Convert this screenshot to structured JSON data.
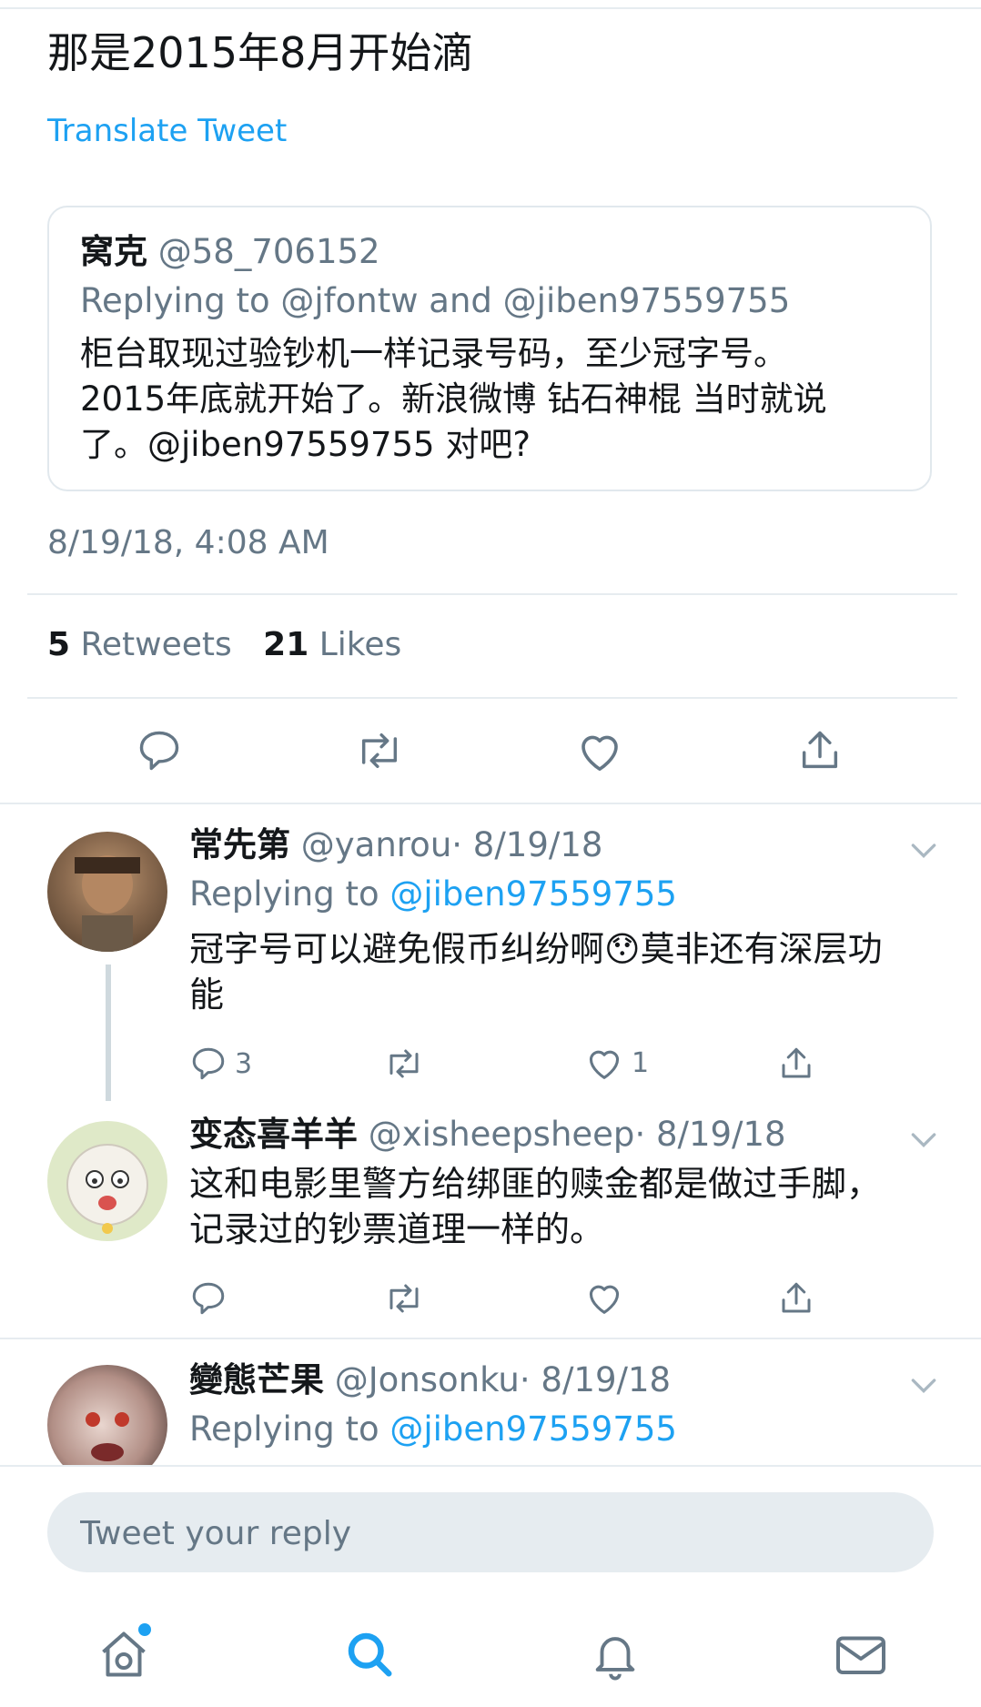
{
  "tweet": {
    "text": "那是2015年8月开始滴",
    "translate_label": "Translate Tweet",
    "quoted": {
      "name": "窝克",
      "handle": "@58_706152",
      "replying_prefix": "Replying to ",
      "replying_user1": "@jfontw",
      "replying_and": " and ",
      "replying_user2": "@jiben97559755",
      "text_lines": [
        "柜台取现过验钞机一样记录号码，至少冠字号。",
        "2015年底就开始了。新浪微博 钻石神棍 当时就说",
        "了。@jiben97559755 对吧?"
      ]
    },
    "timestamp": "8/19/18, 4:08 AM",
    "retweets_count": "5",
    "retweets_label": "Retweets",
    "likes_count": "21",
    "likes_label": "Likes"
  },
  "replies": [
    {
      "name": "常先第",
      "handle": "@yanrou",
      "date": "· 8/19/18",
      "replying_prefix": "Replying to ",
      "replying_user": "@jiben97559755",
      "text_lines": [
        "冠字号可以避免假币纠纷啊😯莫非还有深层功",
        "能"
      ],
      "reply_count": "3",
      "retweet_count": "",
      "like_count": "1"
    },
    {
      "name": "变态喜羊羊",
      "handle": "@xisheepsheep",
      "date": "· 8/19/18",
      "text_lines": [
        "这和电影里警方给绑匪的赎金都是做过手脚，",
        "记录过的钞票道理一样的。"
      ],
      "reply_count": "",
      "retweet_count": "",
      "like_count": ""
    },
    {
      "name": "變態芒果",
      "handle": "@Jonsonku",
      "date": "· 8/19/18",
      "replying_prefix": "Replying to ",
      "replying_user": "@jiben97559755"
    }
  ],
  "composer": {
    "placeholder": "Tweet your reply"
  },
  "tabs": [
    {
      "icon": "home-icon",
      "active": false,
      "has_dot": true
    },
    {
      "icon": "search-icon",
      "active": true
    },
    {
      "icon": "notifications-icon",
      "active": false
    },
    {
      "icon": "messages-icon",
      "active": false
    }
  ],
  "colors": {
    "accent": "#1da1f2",
    "secondary_text": "#657786",
    "primary_text": "#14171a",
    "divider": "#e6ecf0"
  }
}
